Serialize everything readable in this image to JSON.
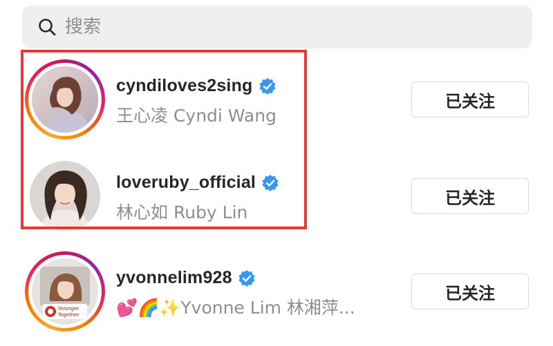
{
  "search": {
    "placeholder": "搜索",
    "icon": "search-icon"
  },
  "users": [
    {
      "username": "cyndiloves2sing",
      "full_name": "王心凌 Cyndi Wang",
      "verified": true,
      "follow_label": "已关注",
      "has_story_ring": true
    },
    {
      "username": "loveruby_official",
      "full_name": "林心如 Ruby Lin",
      "verified": true,
      "follow_label": "已关注",
      "has_story_ring": false
    },
    {
      "username": "yvonnelim928",
      "full_name": "💕🌈✨Yvonne Lim 林湘萍...",
      "verified": true,
      "follow_label": "已关注",
      "has_story_ring": true,
      "avatar_badge": "Stronger Together"
    }
  ],
  "colors": {
    "highlight": "#e53935",
    "verified": "#3897f0",
    "secondary_text": "#8e8e8e",
    "primary_text": "#262626"
  }
}
